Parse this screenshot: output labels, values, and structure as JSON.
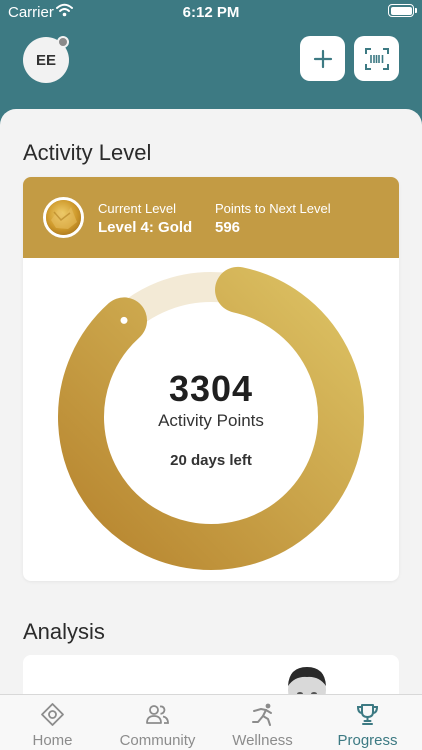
{
  "status_bar": {
    "carrier": "Carrier",
    "time": "6:12 PM"
  },
  "header": {
    "avatar_initials": "EE",
    "add_icon": "plus-icon",
    "scan_icon": "barcode-scan-icon"
  },
  "activity": {
    "section_title": "Activity Level",
    "current_level_caption": "Current Level",
    "current_level_value": "Level 4: Gold",
    "next_level_caption": "Points to Next Level",
    "next_level_value": "596",
    "points": "3304",
    "points_caption": "Activity Points",
    "days_left": "20 days left",
    "progress_fraction": 0.85,
    "colors": {
      "gold": "#c39b44",
      "ring_track": "#f3ead6",
      "ring_start": "#b7852f",
      "ring_end": "#dcc163"
    }
  },
  "analysis": {
    "section_title": "Analysis"
  },
  "tabs": [
    {
      "label": "Home",
      "icon": "home-icon"
    },
    {
      "label": "Community",
      "icon": "community-icon"
    },
    {
      "label": "Wellness",
      "icon": "wellness-icon"
    },
    {
      "label": "Progress",
      "icon": "trophy-icon"
    }
  ],
  "colors": {
    "brand": "#3d7a83",
    "inactive": "#8c8c8c"
  }
}
